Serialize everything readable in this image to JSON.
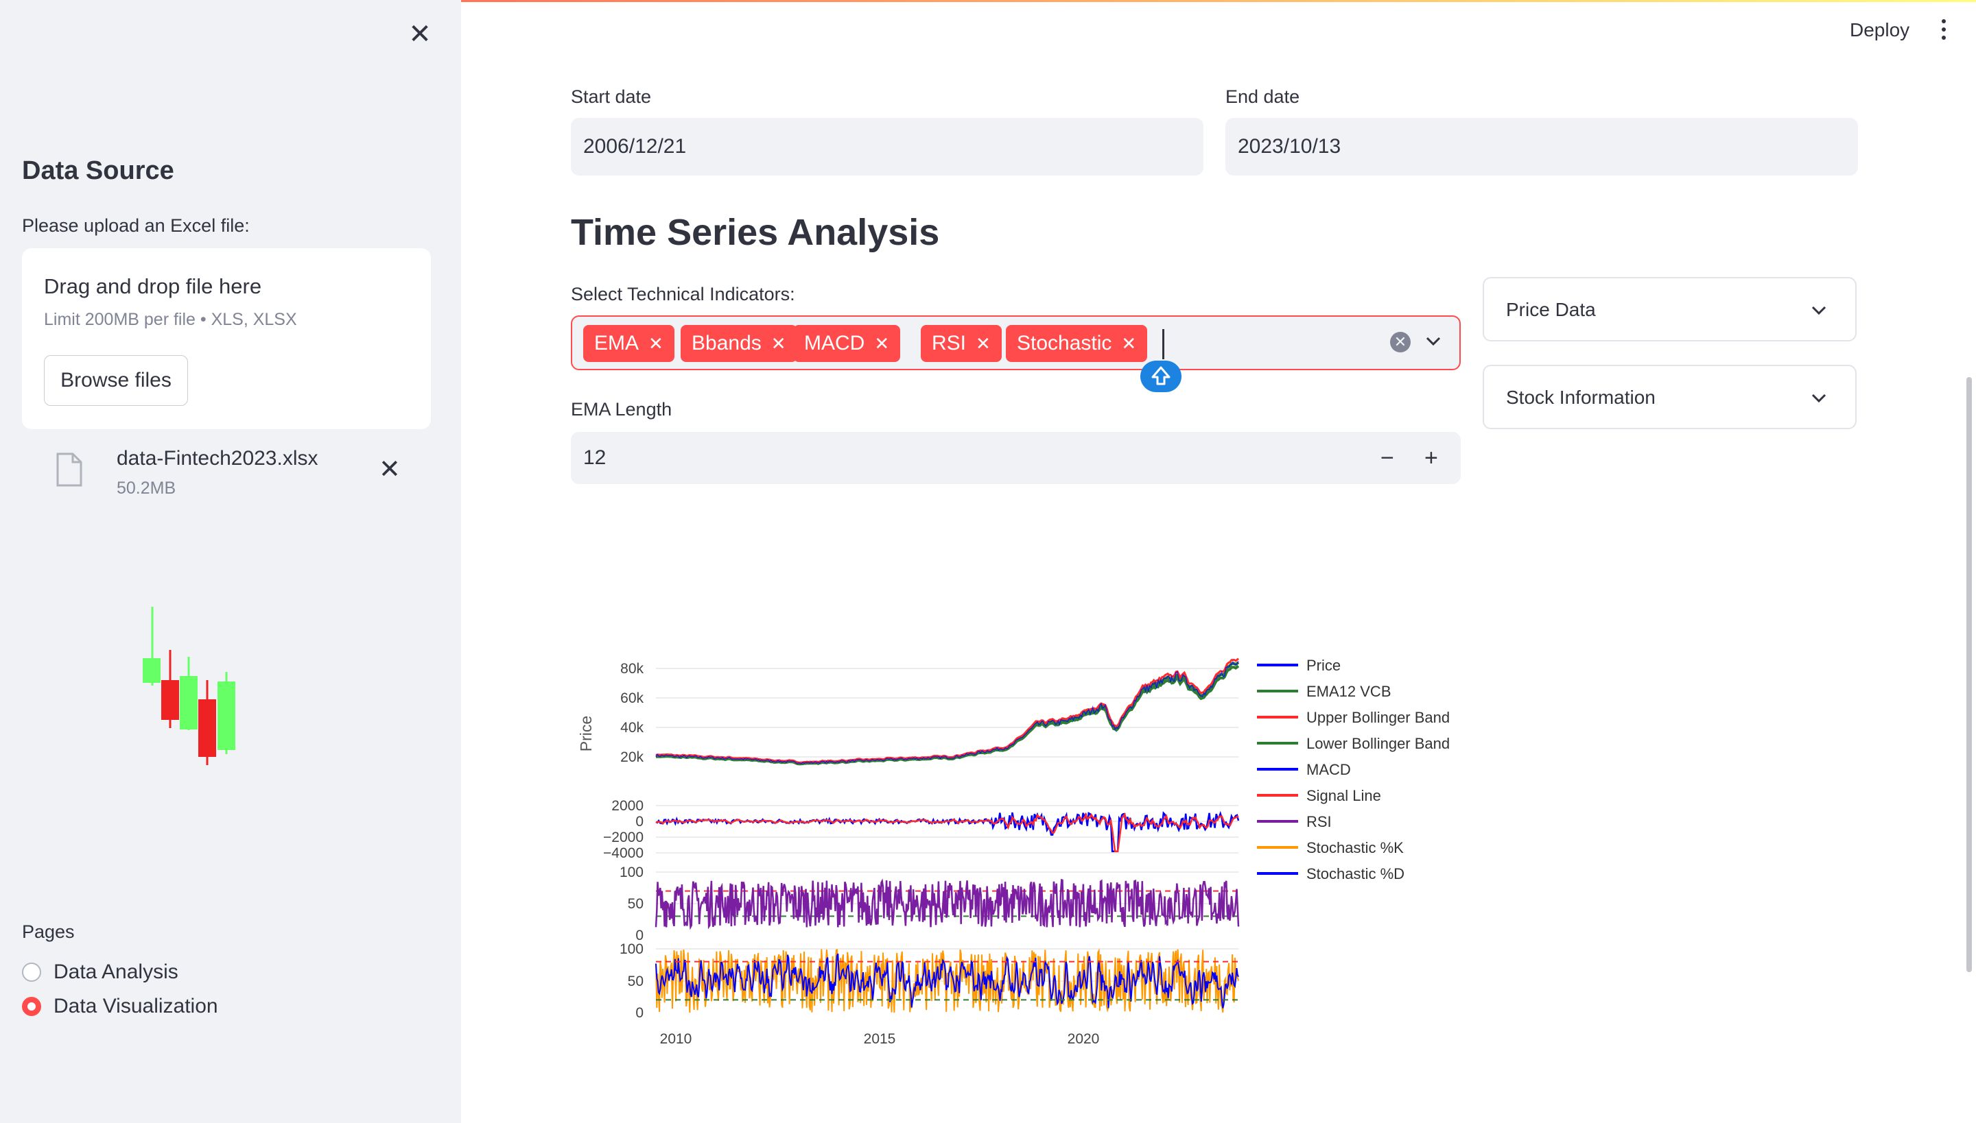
{
  "sidebar": {
    "title": "Data Source",
    "upload_label": "Please upload an Excel file:",
    "dropzone_title": "Drag and drop file here",
    "dropzone_limit": "Limit 200MB per file • XLS, XLSX",
    "browse_label": "Browse files",
    "file_name": "data-Fintech2023.xlsx",
    "file_size": "50.2MB",
    "pages_label": "Pages",
    "pages": [
      {
        "label": "Data Analysis",
        "selected": false
      },
      {
        "label": "Data Visualization",
        "selected": true
      }
    ]
  },
  "header": {
    "deploy_label": "Deploy"
  },
  "main": {
    "start_date_label": "Start date",
    "start_date": "2006/12/21",
    "end_date_label": "End date",
    "end_date": "2023/10/13",
    "heading": "Time Series Analysis",
    "indicators_label": "Select Technical Indicators:",
    "indicators": [
      "EMA",
      "Bbands",
      "MACD",
      "RSI",
      "Stochastic"
    ],
    "ema_length_label": "EMA Length",
    "ema_length": "12",
    "expanders": [
      "Price Data",
      "Stock Information"
    ]
  },
  "colors": {
    "accent": "#ff4b4b",
    "sidebar_bg": "#f0f2f6",
    "info_blue": "#1c83e1"
  },
  "chart_data": {
    "type": "line",
    "x_ticks": [
      "2010",
      "2015",
      "2020"
    ],
    "ylabel": "Price",
    "panels": [
      {
        "name": "price",
        "y_ticks": [
          "80k",
          "60k",
          "40k",
          "20k"
        ]
      },
      {
        "name": "macd",
        "y_ticks": [
          "2000",
          "0",
          "−2000",
          "−4000"
        ]
      },
      {
        "name": "rsi",
        "y_ticks": [
          "100",
          "50",
          "0"
        ]
      },
      {
        "name": "stochastic",
        "y_ticks": [
          "100",
          "50",
          "0"
        ]
      }
    ],
    "series": [
      {
        "name": "Price",
        "color": "#0000ff",
        "x": [
          2008,
          2010,
          2012,
          2014,
          2016,
          2017.5,
          2018.2,
          2019,
          2020,
          2020.3,
          2021,
          2022,
          2022.7,
          2023.5
        ],
        "values": [
          21000,
          19000,
          16000,
          18000,
          20000,
          27000,
          42000,
          44000,
          55000,
          38000,
          65000,
          75000,
          62000,
          86000
        ]
      },
      {
        "name": "EMA12 VCB",
        "color": "#2e7d32"
      },
      {
        "name": "Upper Bollinger Band",
        "color": "#ff2a2a"
      },
      {
        "name": "Lower Bollinger Band",
        "color": "#2e7d32"
      },
      {
        "name": "MACD",
        "color": "#0000ff"
      },
      {
        "name": "Signal Line",
        "color": "#ff2a2a"
      },
      {
        "name": "RSI",
        "color": "#7b1fa2"
      },
      {
        "name": "Stochastic %K",
        "color": "#ff9900"
      },
      {
        "name": "Stochastic %D",
        "color": "#0000ff"
      }
    ]
  }
}
